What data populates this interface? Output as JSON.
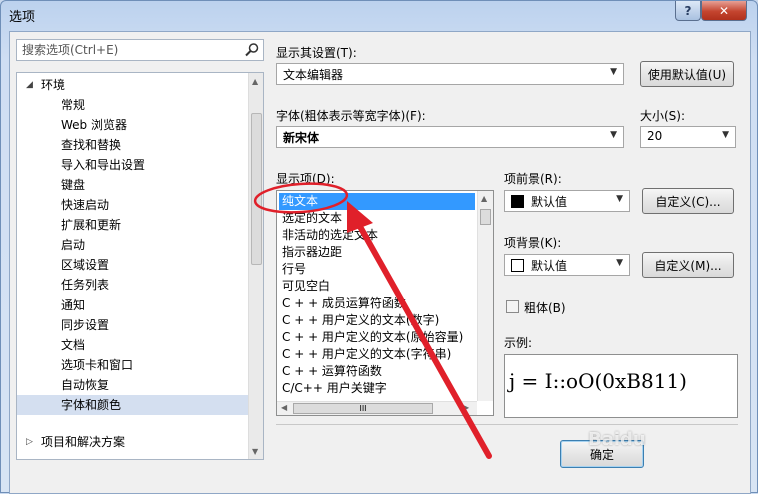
{
  "window": {
    "title": "选项"
  },
  "search": {
    "placeholder": "搜索选项(Ctrl+E)"
  },
  "tree": {
    "root": "环境",
    "items": [
      "常规",
      "Web 浏览器",
      "查找和替换",
      "导入和导出设置",
      "键盘",
      "快速启动",
      "扩展和更新",
      "启动",
      "区域设置",
      "任务列表",
      "通知",
      "同步设置",
      "文档",
      "选项卡和窗口",
      "自动恢复",
      "字体和颜色"
    ],
    "selected": "字体和颜色",
    "partial": "项目和解决方案"
  },
  "display_settings": {
    "label": "显示其设置(T):",
    "value": "文本编辑器",
    "default_button": "使用默认值(U)"
  },
  "font": {
    "label": "字体(粗体表示等宽字体)(F):",
    "value": "新宋体"
  },
  "size": {
    "label": "大小(S):",
    "value": "20"
  },
  "display_items": {
    "label": "显示项(D):",
    "items": [
      "纯文本",
      "选定的文本",
      "非活动的选定文本",
      "指示器边距",
      "行号",
      "可见空白",
      "C + + 成员运算符函数",
      "C + + 用户定义的文本(数字)",
      "C + + 用户定义的文本(原始容量)",
      "C + + 用户定义的文本(字符串)",
      "C + + 运算符函数",
      "C/C++ 用户关键字"
    ],
    "selected": "纯文本"
  },
  "foreground": {
    "label": "项前景(R):",
    "value": "默认值",
    "button": "自定义(C)...",
    "swatch_color": "#000000"
  },
  "background": {
    "label": "项背景(K):",
    "value": "默认值",
    "button": "自定义(M)...",
    "swatch_color": "#ffffff"
  },
  "bold": {
    "label": "粗体(B)"
  },
  "sample": {
    "label": "示例:",
    "text": "j = I::oO(0xB811)"
  },
  "ok_button": {
    "label": "确定"
  },
  "watermark": {
    "text": "Baidu"
  },
  "scrollbar": {
    "grip": "III"
  },
  "annotation": {
    "color": "#e0202a"
  }
}
